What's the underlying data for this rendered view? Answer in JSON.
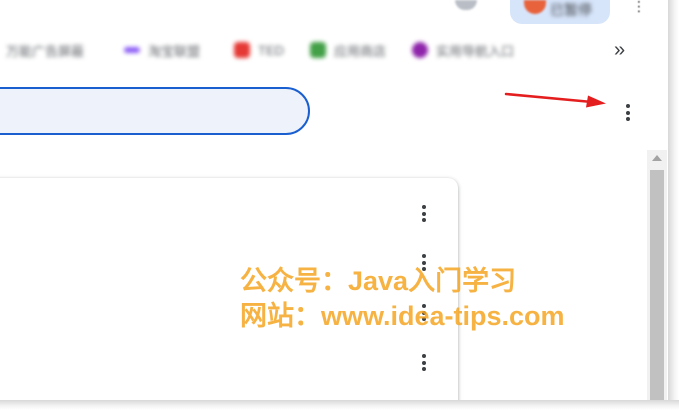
{
  "top_bar": {
    "profile_name": "已暂停",
    "menu_icon": "vertical-ellipsis-icon"
  },
  "bookmarks": {
    "items": [
      {
        "label": "万能广告屏蔽",
        "color": "#9aa0a6"
      },
      {
        "label": "淘宝联盟",
        "color": "#8b5cf6"
      },
      {
        "label": "TED",
        "color": "#e53935"
      },
      {
        "label": "应用商店",
        "color": "#43a047"
      },
      {
        "label": "实用导航入口",
        "color": "#8e24aa"
      }
    ],
    "more_label": "»"
  },
  "toolbar": {
    "menu_icon": "vertical-ellipsis-icon",
    "pointer": "red-arrow-annotation"
  },
  "colors": {
    "accent_blue": "#1a5fd0",
    "arrow_red": "#e41e1e",
    "watermark_orange": "#f5a623"
  },
  "watermark": {
    "line1": "公众号：Java入门学习",
    "line2": "网站：www.idea-tips.com"
  }
}
